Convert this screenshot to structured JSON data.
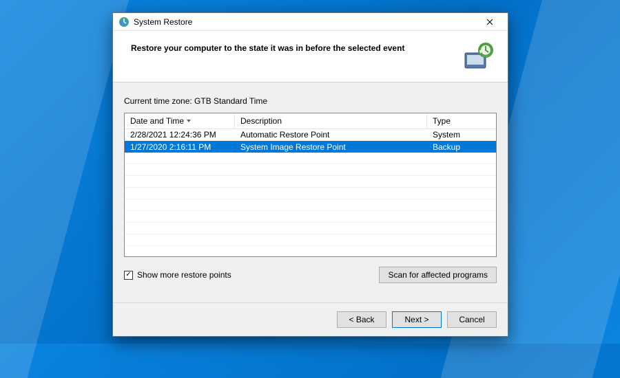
{
  "window": {
    "title": "System Restore",
    "heading": "Restore your computer to the state it was in before the selected event"
  },
  "content": {
    "tz_label": "Current time zone: GTB Standard Time",
    "columns": {
      "date": "Date and Time",
      "desc": "Description",
      "type": "Type"
    },
    "rows": [
      {
        "date": "2/28/2021 12:24:36 PM",
        "desc": "Automatic Restore Point",
        "type": "System",
        "selected": false
      },
      {
        "date": "1/27/2020 2:16:11 PM",
        "desc": "System Image Restore Point",
        "type": "Backup",
        "selected": true
      }
    ],
    "show_more_checked": true,
    "show_more_label": "Show more restore points",
    "scan_button": "Scan for affected programs"
  },
  "footer": {
    "back": "< Back",
    "next": "Next >",
    "cancel": "Cancel"
  }
}
